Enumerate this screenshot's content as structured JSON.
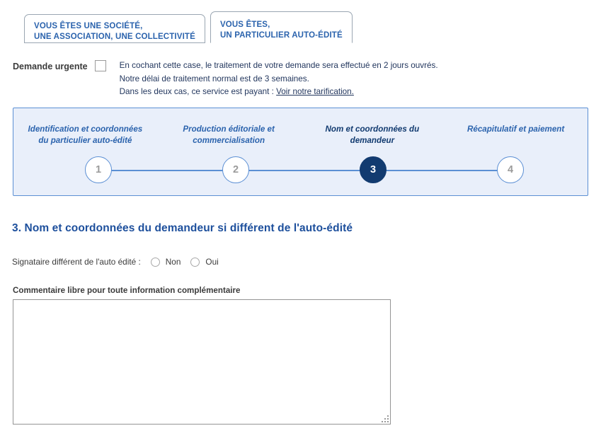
{
  "tabs": [
    {
      "line1": "VOUS ÊTES UNE SOCIÉTÉ,",
      "line2": "UNE ASSOCIATION, UNE COLLECTIVITÉ",
      "active": false
    },
    {
      "line1": "VOUS ÊTES,",
      "line2": "UN PARTICULIER AUTO-ÉDITÉ",
      "active": true
    }
  ],
  "urgent": {
    "label": "Demande urgente",
    "line1": "En cochant cette case, le traitement de votre demande sera effectué en 2 jours ouvrés.",
    "line2": "Notre délai de traitement normal est de 3 semaines.",
    "line3_prefix": "Dans les deux cas, ce service est payant : ",
    "link_text": "Voir notre tarification.",
    "checked": false
  },
  "stepper": {
    "steps": [
      {
        "number": "1",
        "label": "Identification et coordonnées du particulier auto-édité",
        "active": false
      },
      {
        "number": "2",
        "label": "Production éditoriale et commercialisation",
        "active": false
      },
      {
        "number": "3",
        "label": "Nom et coordonnées du demandeur",
        "active": true
      },
      {
        "number": "4",
        "label": "Récapitulatif et paiement",
        "active": false
      }
    ],
    "current_step": 3,
    "total_steps": 4
  },
  "section": {
    "title": "3. Nom et coordonnées du demandeur si différent de l'auto-édité"
  },
  "signatory": {
    "question": "Signataire différent de l'auto édité :",
    "options": [
      {
        "label": "Non",
        "selected": false
      },
      {
        "label": "Oui",
        "selected": false
      }
    ]
  },
  "comment": {
    "label": "Commentaire libre pour toute information complémentaire",
    "value": "",
    "placeholder": ""
  },
  "colors": {
    "brand_blue": "#2b63ad",
    "navy": "#123b70",
    "panel_bg": "#e9effa",
    "panel_border": "#5b8fd4",
    "heading": "#1d4f9c"
  }
}
